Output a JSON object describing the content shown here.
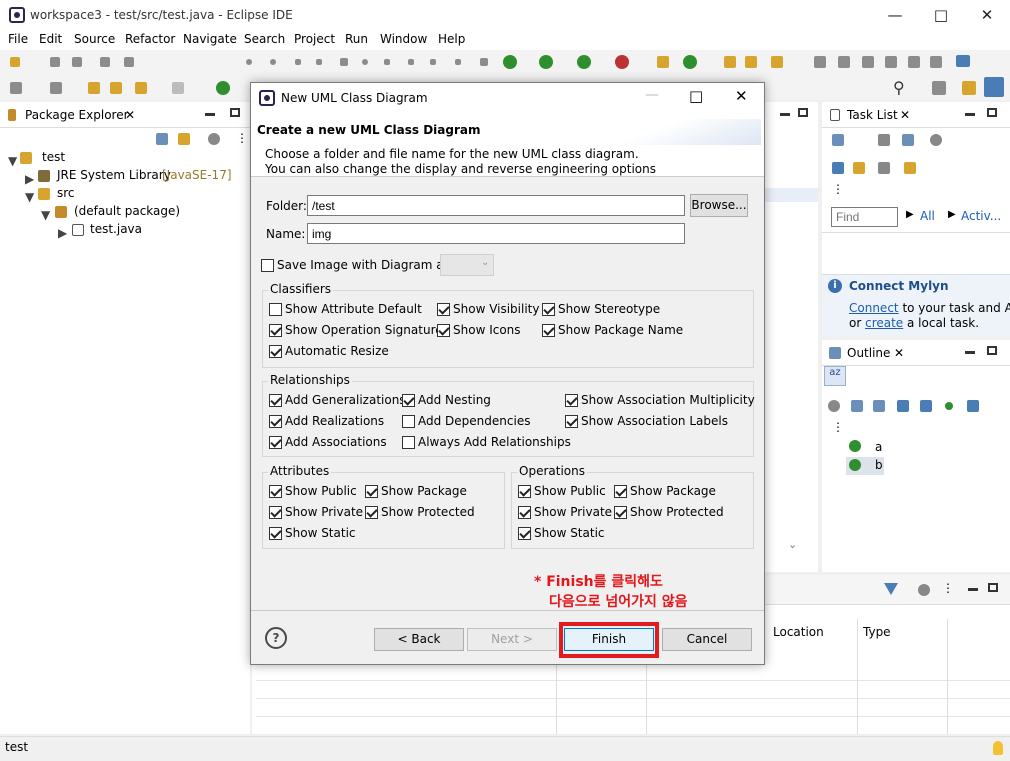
{
  "window": {
    "title": "workspace3 - test/src/test.java - Eclipse IDE"
  },
  "menu": [
    "File",
    "Edit",
    "Source",
    "Refactor",
    "Navigate",
    "Search",
    "Project",
    "Run",
    "Window",
    "Help"
  ],
  "package_explorer": {
    "tab": "Package Explorer",
    "tree": {
      "project": "test",
      "jre": "JRE System Library",
      "jre_version": "[JavaSE-17]",
      "src": "src",
      "package": "(default package)",
      "file": "test.java"
    }
  },
  "task_list": {
    "tab": "Task List",
    "find_placeholder": "Find",
    "all": "All",
    "activate": "Activ..."
  },
  "mylyn": {
    "title": "Connect Mylyn",
    "connect": "Connect",
    "text1": " to your task and ALM",
    "or": "or ",
    "create": "create",
    "text2": " a local task."
  },
  "outline": {
    "tab": "Outline",
    "items": [
      "a",
      "b"
    ]
  },
  "bottom_table": {
    "headers": [
      "Location",
      "Type"
    ]
  },
  "status": {
    "text": "test"
  },
  "dialog": {
    "title": "New UML Class Diagram",
    "heading": "Create a new UML Class Diagram",
    "desc1": "Choose a folder and file name for the new UML class diagram.",
    "desc2": "You can also change the display and reverse engineering options",
    "folder_label": "Folder:",
    "folder_value": "/test",
    "browse": "Browse...",
    "name_label": "Name:",
    "name_value": "img",
    "save_image": "Save Image with Diagram as",
    "classifiers": {
      "title": "Classifiers",
      "show_attr_default": "Show Attribute Default",
      "show_visibility": "Show Visibility",
      "show_stereotype": "Show Stereotype",
      "show_op_sig": "Show Operation Signature",
      "show_icons": "Show Icons",
      "show_pkg_name": "Show Package Name",
      "auto_resize": "Automatic Resize"
    },
    "relationships": {
      "title": "Relationships",
      "add_gen": "Add Generalizations",
      "add_nesting": "Add Nesting",
      "show_assoc_mult": "Show Association Multiplicity",
      "add_real": "Add Realizations",
      "add_dep": "Add Dependencies",
      "show_assoc_labels": "Show Association Labels",
      "add_assoc": "Add Associations",
      "always_add": "Always Add Relationships"
    },
    "attributes": {
      "title": "Attributes",
      "pub": "Show Public",
      "pkg": "Show Package",
      "priv": "Show Private",
      "prot": "Show Protected",
      "stat": "Show Static"
    },
    "operations": {
      "title": "Operations",
      "pub": "Show Public",
      "pkg": "Show Package",
      "priv": "Show Private",
      "prot": "Show Protected",
      "stat": "Show Static"
    },
    "annotation1": "* Finish를 클릭해도",
    "annotation2": "다음으로 넘어가지 않음",
    "buttons": {
      "back": "< Back",
      "next": "Next >",
      "finish": "Finish",
      "cancel": "Cancel"
    }
  }
}
